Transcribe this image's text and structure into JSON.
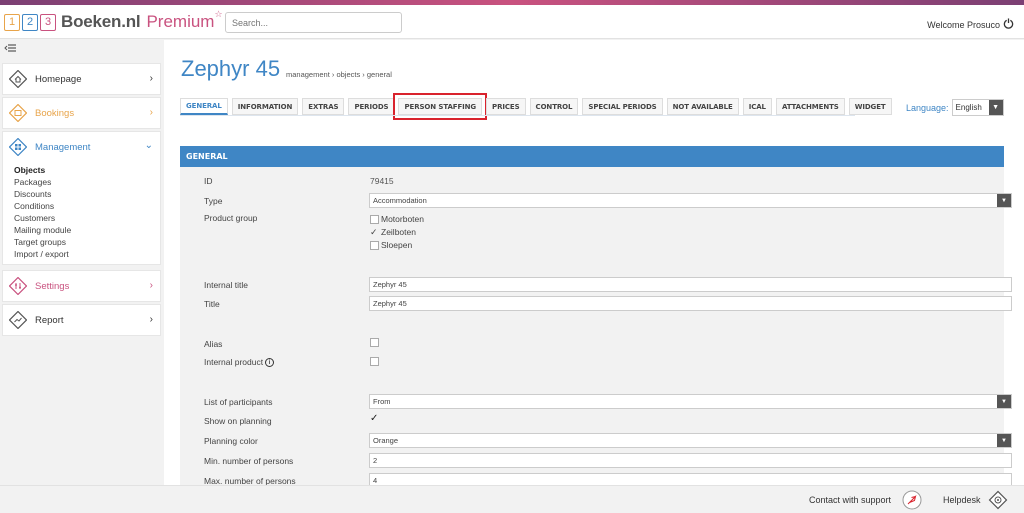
{
  "header": {
    "logo_digits": [
      "1",
      "2",
      "3"
    ],
    "brand": "Boeken.nl",
    "premium": "Premium",
    "premium_star": "☆",
    "search_placeholder": "Search...",
    "welcome": "Welcome Prosuco"
  },
  "sidebar": {
    "homepage": "Homepage",
    "bookings": "Bookings",
    "management": "Management",
    "management_items": [
      "Objects",
      "Packages",
      "Discounts",
      "Conditions",
      "Customers",
      "Mailing module",
      "Target groups",
      "Import / export"
    ],
    "settings": "Settings",
    "report": "Report",
    "colors": {
      "homepage": "#333333",
      "bookings": "#e8a44a",
      "management": "#3f86c5",
      "settings": "#c9527f",
      "report": "#333333"
    }
  },
  "page": {
    "title": "Zephyr 45",
    "breadcrumb": "management › objects › general",
    "tabs": [
      "GENERAL",
      "INFORMATION",
      "EXTRAS",
      "PERIODS",
      "PERSON STAFFING",
      "PRICES",
      "CONTROL",
      "SPECIAL PERIODS",
      "NOT AVAILABLE",
      "ICAL",
      "ATTACHMENTS",
      "WIDGET"
    ],
    "active_tab": "GENERAL",
    "language_label": "Language:",
    "language_value": "English"
  },
  "panel": {
    "title": "GENERAL",
    "id_label": "ID",
    "id_value": "79415",
    "type_label": "Type",
    "type_value": "Accommodation",
    "product_group_label": "Product group",
    "product_groups": [
      {
        "label": "Motorboten",
        "checked": false
      },
      {
        "label": "Zeilboten",
        "checked": true
      },
      {
        "label": "Sloepen",
        "checked": false
      }
    ],
    "internal_title_label": "Internal title",
    "internal_title_value": "Zephyr 45",
    "title_label": "Title",
    "title_value": "Zephyr 45",
    "alias_label": "Alias",
    "internal_product_label": "Internal product",
    "participants_label": "List of participants",
    "participants_value": "From",
    "show_planning_label": "Show on planning",
    "planning_color_label": "Planning color",
    "planning_color_value": "Orange",
    "min_persons_label": "Min. number of persons",
    "min_persons_value": "2",
    "max_persons_label": "Max. number of persons",
    "max_persons_value": "4"
  },
  "footer": {
    "support": "Contact with support",
    "helpdesk": "Helpdesk"
  },
  "colors": {
    "accent": "#3f86c5",
    "highlight": "#d9232d"
  }
}
